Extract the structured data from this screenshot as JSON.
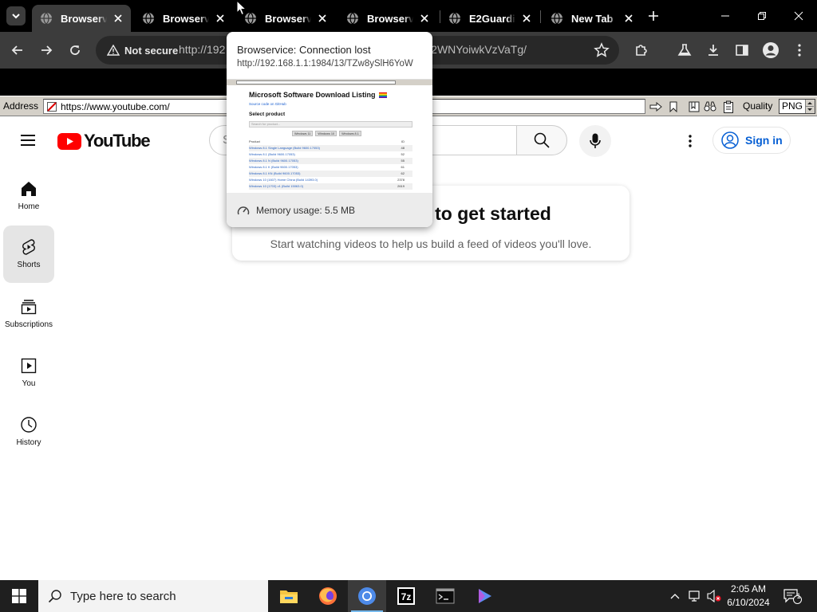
{
  "browser": {
    "tabs": [
      {
        "title": "Browservice: Connection lost",
        "active": true
      },
      {
        "title": "Browservice: Connection lost",
        "active": false
      },
      {
        "title": "Browservice: Connection lost",
        "active": false
      },
      {
        "title": "Browservice: Connection lost",
        "active": false
      },
      {
        "title": "E2Guardian",
        "active": false
      },
      {
        "title": "New Tab",
        "active": false
      }
    ],
    "security_chip": "Not secure",
    "url_prefix": "http://192",
    "url_suffix": "52WNYoiwkVzVaTg/"
  },
  "hover_card": {
    "title": "Browservice: Connection lost",
    "url": "http://192.168.1.1:1984/13/TZw8ySlH6YoW",
    "memory": "Memory usage: 5.5 MB",
    "thumbnail": {
      "title": "Microsoft Software Download Listing",
      "link": "Source code on GitHub",
      "select_label": "Select product",
      "input_placeholder": "Search for product...",
      "filters": [
        "Windows 11",
        "Windows 10",
        "Windows 8.1"
      ],
      "col_product": "Product",
      "col_id": "ID",
      "rows": [
        {
          "name": "Windows 8.1 Single Language (Build 9600.17053)",
          "id": "48"
        },
        {
          "name": "Windows 8.1 (Build 9600.17053)",
          "id": "52"
        },
        {
          "name": "Windows 8.1 N (Build 9600.17053)",
          "id": "55"
        },
        {
          "name": "Windows 8.1 K (Build 9600.17053)",
          "id": "61"
        },
        {
          "name": "Windows 8.1 KN (Build 9600.17053)",
          "id": "62"
        },
        {
          "name": "Windows 10 (1607) Home China (Build 14393.0)",
          "id": "2378"
        },
        {
          "name": "Windows 10 (1703) v1 (Build 15063.0)",
          "id": "2619"
        }
      ]
    }
  },
  "browservice": {
    "address_label": "Address",
    "address_value": "https://www.youtube.com/",
    "quality_label": "Quality",
    "quality_value": "PNG"
  },
  "youtube": {
    "logo_text": "YouTube",
    "search_placeholder": "Search",
    "sign_in": "Sign in",
    "sidebar": [
      {
        "label": "Home",
        "icon": "home-icon"
      },
      {
        "label": "Shorts",
        "icon": "shorts-icon",
        "active": true
      },
      {
        "label": "Subscriptions",
        "icon": "subscriptions-icon"
      },
      {
        "label": "You",
        "icon": "you-icon"
      },
      {
        "label": "History",
        "icon": "history-icon"
      }
    ],
    "card_title": "Try searching to get started",
    "card_subtitle": "Start watching videos to help us build a feed of videos you'll love."
  },
  "taskbar": {
    "search_placeholder": "Type here to search",
    "time": "2:05 AM",
    "date": "6/10/2024",
    "notification_count": "1",
    "apps": [
      "file-explorer",
      "firefox",
      "chromium",
      "7-zip",
      "terminal",
      "media-player"
    ]
  },
  "colors": {
    "youtube_red": "#ff0000",
    "link_blue": "#065fd4",
    "taskbar_accent": "#76b9ed"
  }
}
